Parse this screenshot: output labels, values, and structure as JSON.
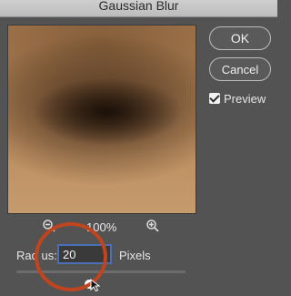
{
  "window": {
    "title": "Gaussian Blur"
  },
  "buttons": {
    "ok": "OK",
    "cancel": "Cancel"
  },
  "preview_toggle": {
    "label": "Preview",
    "checked": true
  },
  "zoom": {
    "level": "100%"
  },
  "radius": {
    "label": "Rad us:",
    "value": "20",
    "units": "Pixels"
  },
  "slider": {
    "value": 20
  },
  "colors": {
    "highlight": "#c0451f",
    "accent": "#4a6fb6"
  },
  "icons": [
    "zoom-out-icon",
    "zoom-in-icon",
    "checkmark-icon",
    "mouse-cursor-icon"
  ]
}
